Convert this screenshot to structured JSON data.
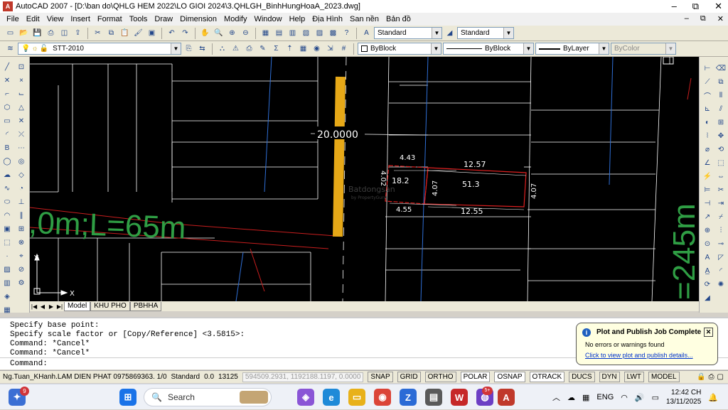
{
  "window": {
    "title": "AutoCAD 2007 - [D:\\ban do\\QHLG HEM 2022\\LO GIOI 2024\\3.QHLGH_BinhHungHoaA_2023.dwg]",
    "min": "–",
    "max": "⧉",
    "close": "✕"
  },
  "menu": [
    "File",
    "Edit",
    "View",
    "Insert",
    "Format",
    "Tools",
    "Draw",
    "Dimension",
    "Modify",
    "Window",
    "Help",
    "Địa Hình",
    "San nền",
    "Bản đồ"
  ],
  "toolbar1": {
    "text_style": "Standard",
    "dim_style": "Standard"
  },
  "toolbar2": {
    "layer": "STT-2010",
    "color": "ByBlock",
    "linetype": "ByBlock",
    "lineweight": "ByLayer",
    "plotstyle": "ByColor"
  },
  "drawing": {
    "dim_top": "20.0000",
    "left_text": ",0m;L=65m",
    "right_text": "=245m",
    "lot_small": {
      "width_top": "4.43",
      "width_bottom": "4.55",
      "height_left": "4.02",
      "area": "18.2"
    },
    "lot_big": {
      "width_top": "12.57",
      "width_bottom": "12.55",
      "height_left": "4.07",
      "height_right": "4.07",
      "area": "51.3"
    },
    "watermark": "Batdongsan",
    "watermark_sub": "by PropertyGuru",
    "ucs_x": "X",
    "ucs_y": "Y"
  },
  "tabs": [
    "Model",
    "KHU PHO",
    "PBHHA"
  ],
  "command_history": [
    "Specify base point:",
    "Specify scale factor or [Copy/Reference] <3.5815>:",
    "Command: *Cancel*",
    "Command: *Cancel*"
  ],
  "command_prompt": "Command:",
  "status": {
    "user": "Ng.Tuan_KHanh.LAM DIEN PHAT 0975869363. 1/0",
    "style": "Standard",
    "value1": "0.0",
    "value2": "13125",
    "coords": "594509.2931, 1192188.1197, 0.0000",
    "buttons": [
      "SNAP",
      "GRID",
      "ORTHO",
      "POLAR",
      "OSNAP",
      "OTRACK",
      "DUCS",
      "DYN",
      "LWT",
      "MODEL"
    ]
  },
  "notification": {
    "title": "Plot and Publish Job Complete",
    "message": "No errors or warnings found",
    "link": "Click to view plot and publish details..."
  },
  "taskbar": {
    "search_placeholder": "Search",
    "badge": "9",
    "badge2": "5+",
    "lang": "ENG",
    "time": "12:42 CH",
    "date": "13/11/2025"
  },
  "colors": {
    "dim_lines": "#ffffff",
    "lot_outline": "#e02020",
    "road_yellow": "#e6a817",
    "green_text": "#2f9e44",
    "blue_lines": "#2f6fd6"
  }
}
